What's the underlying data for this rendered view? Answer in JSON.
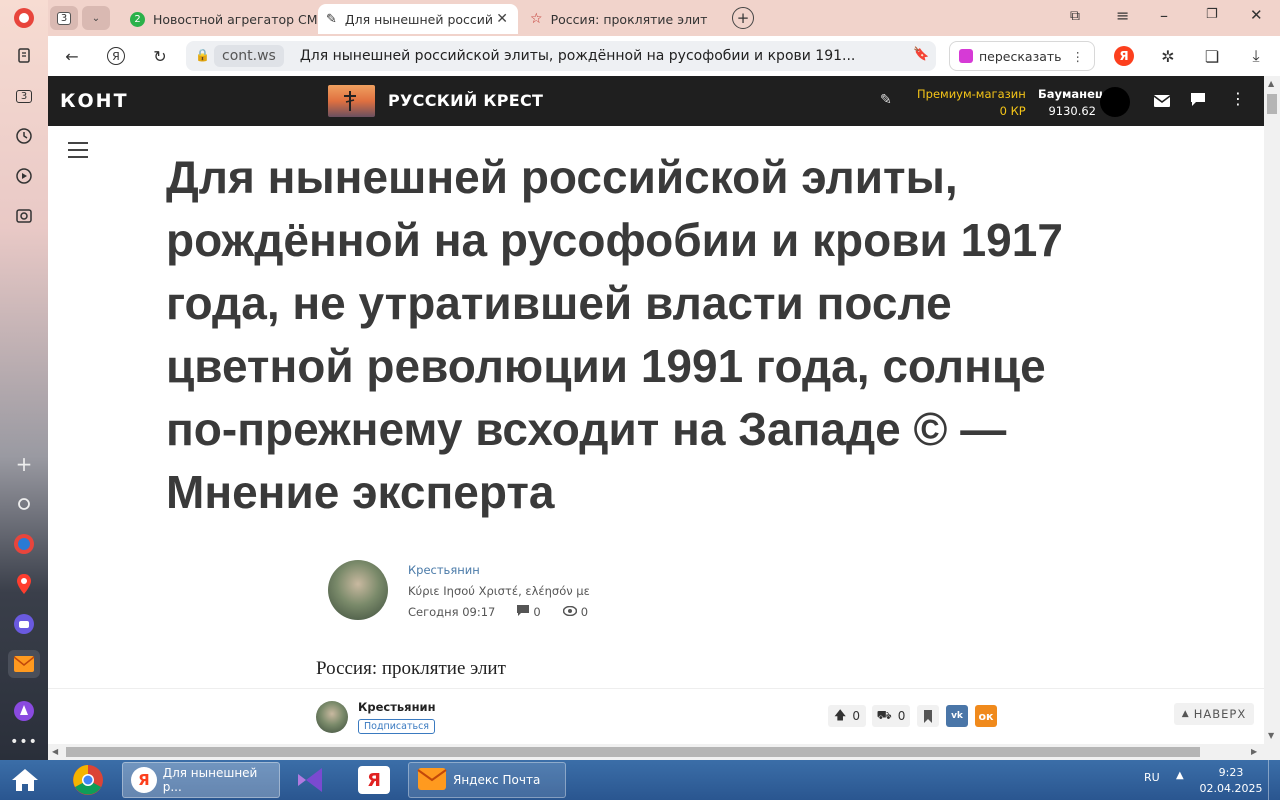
{
  "tabs": {
    "counter": "3",
    "list": [
      {
        "badge": "2",
        "label": "Новостной агрегатор СМ"
      },
      {
        "label": "Для нынешней россий"
      },
      {
        "label": "Россия: проклятие элит"
      }
    ]
  },
  "address_bar": {
    "domain": "cont.ws",
    "page_title": "Для нынешней российской элиты, рождённой на русофобии и крови 191...",
    "retell_label": "пересказать"
  },
  "rail": {
    "tab_count": "3"
  },
  "site_header": {
    "logo": "КОНТ",
    "channel": "РУССКИЙ КРЕСТ",
    "premium_label": "Премиум-магазин",
    "premium_balance": "0 КР",
    "username": "Бауманец",
    "user_score": "9130.62"
  },
  "article": {
    "title": "Для нынешней российской элиты, рождённой на русофобии и крови 1917 года, не утратившей власти после цветной революции 1991 года, солнце по-прежнему всходит на Западе © — Мнение эксперта",
    "author": "Крестьянин",
    "author_motto": "Κύριε Ιησού Χριστέ, ελέησόν με",
    "time": "Сегодня 09:17",
    "comments": "0",
    "views": "0",
    "lead": "Россия: проклятие элит"
  },
  "sticky_bar": {
    "author": "Крестьянин",
    "subscribe": "Подписаться",
    "upvotes": "0",
    "reposts": "0",
    "to_top": "НАВЕРХ"
  },
  "taskbar": {
    "windows": [
      {
        "label": "Для нынешней р..."
      },
      {
        "label": "Яндекс Почта"
      }
    ],
    "lang": "RU",
    "time": "9:23",
    "date": "02.04.2025"
  },
  "colors": {
    "accent_premium": "#f5c518",
    "header_bg": "#1f1f1f",
    "title_text": "#3a3a3a",
    "link_blue": "#4a7aa8"
  }
}
